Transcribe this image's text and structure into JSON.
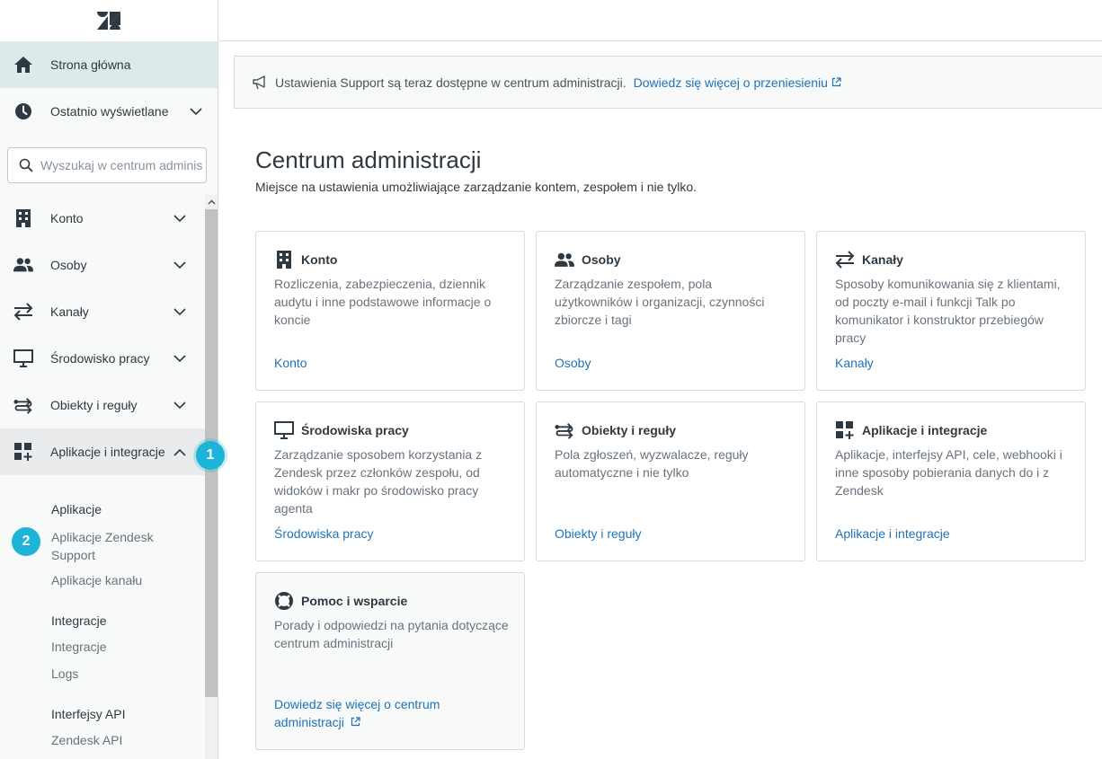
{
  "sidebar": {
    "home": {
      "label": "Strona główna",
      "icon": "home-icon"
    },
    "recent": {
      "label": "Ostatnio wyświetlane",
      "icon": "clock-icon"
    },
    "search": {
      "placeholder": "Wyszukaj w centrum administracji"
    },
    "items": [
      {
        "label": "Konto",
        "icon": "building-icon"
      },
      {
        "label": "Osoby",
        "icon": "people-icon"
      },
      {
        "label": "Kanały",
        "icon": "arrows-icon"
      },
      {
        "label": "Środowisko pracy",
        "icon": "monitor-icon"
      },
      {
        "label": "Obiekty i reguły",
        "icon": "objects-rules-icon"
      },
      {
        "label": "Aplikacje i integracje",
        "icon": "apps-icon"
      }
    ],
    "subsections": {
      "apps_heading": "Aplikacje",
      "apps_support": "Aplikacje Zendesk Support",
      "apps_channel": "Aplikacje kanału",
      "integrations_heading": "Integracje",
      "integrations": "Integracje",
      "logs": "Logs",
      "api_heading": "Interfejsy API",
      "zendesk_api": "Zendesk API"
    },
    "badges": {
      "one": "1",
      "two": "2"
    }
  },
  "notice": {
    "text": "Ustawienia Support są teraz dostępne w centrum administracji.",
    "link": "Dowiedz się więcej o przeniesieniu"
  },
  "main": {
    "title": "Centrum administracji",
    "subtitle": "Miejsce na ustawienia umożliwiające zarządzanie kontem, zespołem i nie tylko.",
    "cards": [
      {
        "title": "Konto",
        "desc": "Rozliczenia, zabezpieczenia, dziennik audytu i inne podstawowe informacje o koncie",
        "link": "Konto"
      },
      {
        "title": "Osoby",
        "desc": "Zarządzanie zespołem, pola użytkowników i organizacji, czynności zbiorcze i tagi",
        "link": "Osoby"
      },
      {
        "title": "Kanały",
        "desc": "Sposoby komunikowania się z klientami, od poczty e-mail i funkcji Talk po komunikator i konstruktor przebiegów pracy",
        "link": "Kanały"
      },
      {
        "title": "Środowiska pracy",
        "desc": "Zarządzanie sposobem korzystania z Zendesk przez członków zespołu, od widoków i makr po środowisko pracy agenta",
        "link": "Środowiska pracy"
      },
      {
        "title": "Obiekty i reguły",
        "desc": "Pola zgłoszeń, wyzwalacze, reguły automatyczne i nie tylko",
        "link": "Obiekty i reguły"
      },
      {
        "title": "Aplikacje i integracje",
        "desc": "Aplikacje, interfejsy API, cele, webhooki i inne sposoby pobierania danych do i z Zendesk",
        "link": "Aplikacje i integracje"
      },
      {
        "title": "Pomoc i wsparcie",
        "desc": "Porady i odpowiedzi na pytania dotyczące centrum administracji",
        "link": "Dowiedz się więcej o centrum administracji"
      }
    ]
  },
  "colors": {
    "accent": "#1f73b7",
    "badge": "#1eb3d8",
    "home_active": "#dcebe9"
  }
}
